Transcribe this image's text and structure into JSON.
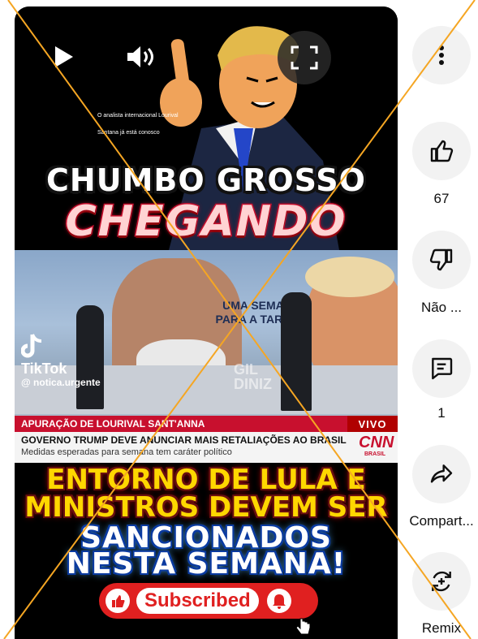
{
  "controls": {
    "play": "play-icon",
    "volume": "volume-icon",
    "fullscreen": "fullscreen-icon"
  },
  "video": {
    "small_caption_line1": "O analista internacional Lourival",
    "small_caption_line2": "Santana já está conosco",
    "headline_line1": "CHUMBO GROSSO",
    "headline_line2": "CHEGANDO",
    "news": {
      "overlay_line1": "UMA SEMANA",
      "overlay_line2": "PARA A TARIFA",
      "watermark": "GIL DINIZ",
      "tiktok_label": "TikTok",
      "tiktok_handle": "@ notica.urgente",
      "ticker_red": "APURAÇÃO DE LOURIVAL SANT'ANNA",
      "ticker_live": "VIVO",
      "ticker_headline": "GOVERNO TRUMP DEVE ANUNCIAR MAIS RETALIAÇÕES AO BRASIL",
      "ticker_subline": "Medidas esperadas para semana tem caráter político",
      "network_logo": "CNN",
      "network_sub": "BRASIL"
    },
    "bottom_line1": "ENTORNO DE LULA E",
    "bottom_line2": "MINISTROS DEVEM SER",
    "bottom_line3": "SANCIONADOS",
    "bottom_line4": "NESTA SEMANA!",
    "subscribe_label": "Subscribed"
  },
  "rail": {
    "more": "more-vert-icon",
    "like_count": "67",
    "dislike_label": "Não ...",
    "comment_count": "1",
    "share_label": "Compart...",
    "remix_label": "Remix"
  },
  "colors": {
    "accent_red": "#c8102e",
    "cross_line": "#f5a623",
    "headline_yellow": "#ffd700"
  }
}
